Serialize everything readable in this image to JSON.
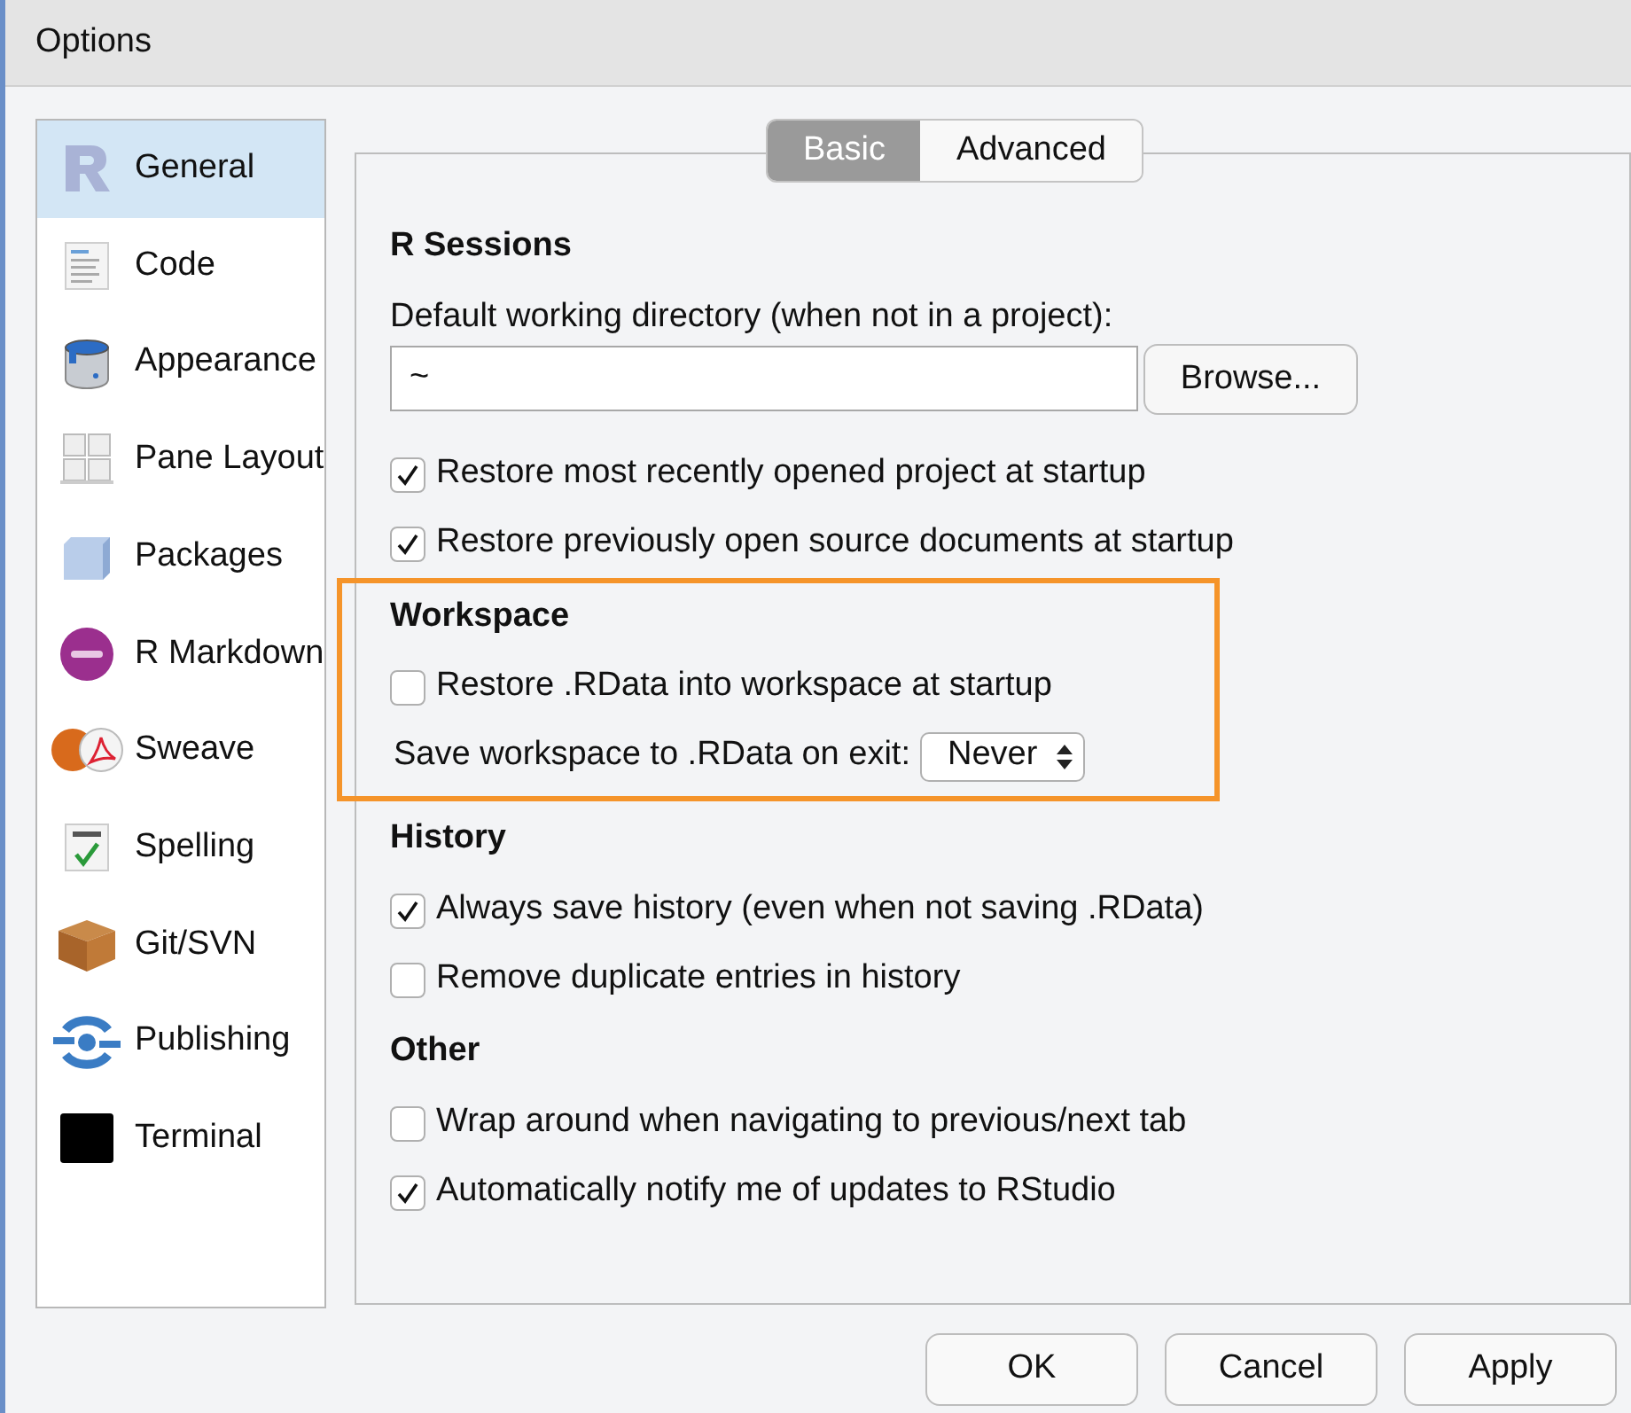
{
  "window": {
    "title": "Options"
  },
  "sidebar": {
    "items": [
      {
        "label": "General",
        "selected": true
      },
      {
        "label": "Code",
        "selected": false
      },
      {
        "label": "Appearance",
        "selected": false
      },
      {
        "label": "Pane Layout",
        "selected": false
      },
      {
        "label": "Packages",
        "selected": false
      },
      {
        "label": "R Markdown",
        "selected": false
      },
      {
        "label": "Sweave",
        "selected": false
      },
      {
        "label": "Spelling",
        "selected": false
      },
      {
        "label": "Git/SVN",
        "selected": false
      },
      {
        "label": "Publishing",
        "selected": false
      },
      {
        "label": "Terminal",
        "selected": false
      }
    ]
  },
  "tabs": [
    {
      "label": "Basic",
      "selected": true
    },
    {
      "label": "Advanced",
      "selected": false
    }
  ],
  "sections": [
    {
      "heading": "R Sessions",
      "highlighted": false,
      "items": [
        {
          "kind": "label",
          "text": "Default working directory (when not in a project):"
        },
        {
          "kind": "directory",
          "value": "~",
          "button": "Browse..."
        },
        {
          "kind": "checkbox",
          "label": "Restore most recently opened project at startup",
          "checked": true
        },
        {
          "kind": "checkbox",
          "label": "Restore previously open source documents at startup",
          "checked": true
        }
      ]
    },
    {
      "heading": "Workspace",
      "highlighted": true,
      "items": [
        {
          "kind": "checkbox",
          "label": "Restore .RData into workspace at startup",
          "checked": false
        },
        {
          "kind": "select",
          "label": "Save workspace to .RData on exit:",
          "value": "Never"
        }
      ]
    },
    {
      "heading": "History",
      "highlighted": false,
      "items": [
        {
          "kind": "checkbox",
          "label": "Always save history (even when not saving .RData)",
          "checked": true
        },
        {
          "kind": "checkbox",
          "label": "Remove duplicate entries in history",
          "checked": false
        }
      ]
    },
    {
      "heading": "Other",
      "highlighted": false,
      "items": [
        {
          "kind": "checkbox",
          "label": "Wrap around when navigating to previous/next tab",
          "checked": false
        },
        {
          "kind": "checkbox",
          "label": "Automatically notify me of updates to RStudio",
          "checked": true
        }
      ]
    }
  ],
  "buttons": [
    {
      "label": "OK"
    },
    {
      "label": "Cancel"
    },
    {
      "label": "Apply"
    }
  ]
}
